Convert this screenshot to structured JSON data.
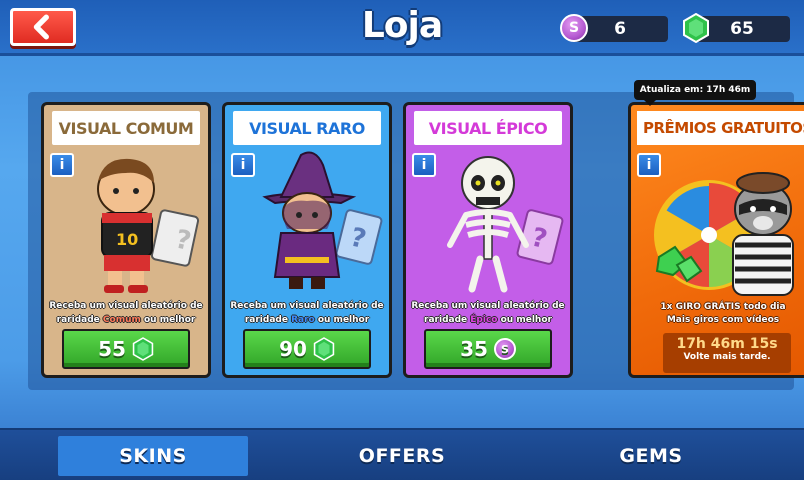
{
  "header": {
    "title": "Loja",
    "coins": "6",
    "gems": "65",
    "coin_symbol": "S"
  },
  "cards": [
    {
      "title": "VISUAL COMUM",
      "title_color": "#8a6a3a",
      "bg": "#d8b58a",
      "desc_line1": "Receba um visual aleatório de",
      "desc_pre": "raridade ",
      "rarity": "Comum",
      "rarity_color": "#ff7a5a",
      "desc_post": " ou melhor",
      "price": "55",
      "currency_icon": "gem-icon"
    },
    {
      "title": "VISUAL RARO",
      "title_color": "#1e73d8",
      "bg": "#3fa8f0",
      "desc_line1": "Receba um visual aleatório de",
      "desc_pre": "raridade ",
      "rarity": "Raro",
      "rarity_color": "#3a8cff",
      "desc_post": " ou melhor",
      "price": "90",
      "currency_icon": "gem-icon"
    },
    {
      "title": "VISUAL ÉPICO",
      "title_color": "#d43ad8",
      "bg": "#c35ee8",
      "desc_line1": "Receba um visual aleatório de",
      "desc_pre": "raridade ",
      "rarity": "Épico",
      "rarity_color": "#e040e6",
      "desc_post": " ou melhor",
      "price": "35",
      "currency_icon": "coin-icon"
    }
  ],
  "rewards": {
    "tooltip": "Atualiza em: 17h 46m",
    "title": "PRÊMIOS GRATUITOS",
    "line1": "1x GIRO GRÁTIS todo dia",
    "line2": "Mais giros com vídeos",
    "countdown": "17h 46m 15s",
    "note": "Volte mais tarde."
  },
  "tabs": [
    {
      "label": "SKINS",
      "active": true
    },
    {
      "label": "OFFERS",
      "active": false
    },
    {
      "label": "GEMS",
      "active": false
    }
  ],
  "colors": {
    "accent_green": "#31a528",
    "back_red": "#e02b22",
    "tab_active": "#2f80dc"
  }
}
